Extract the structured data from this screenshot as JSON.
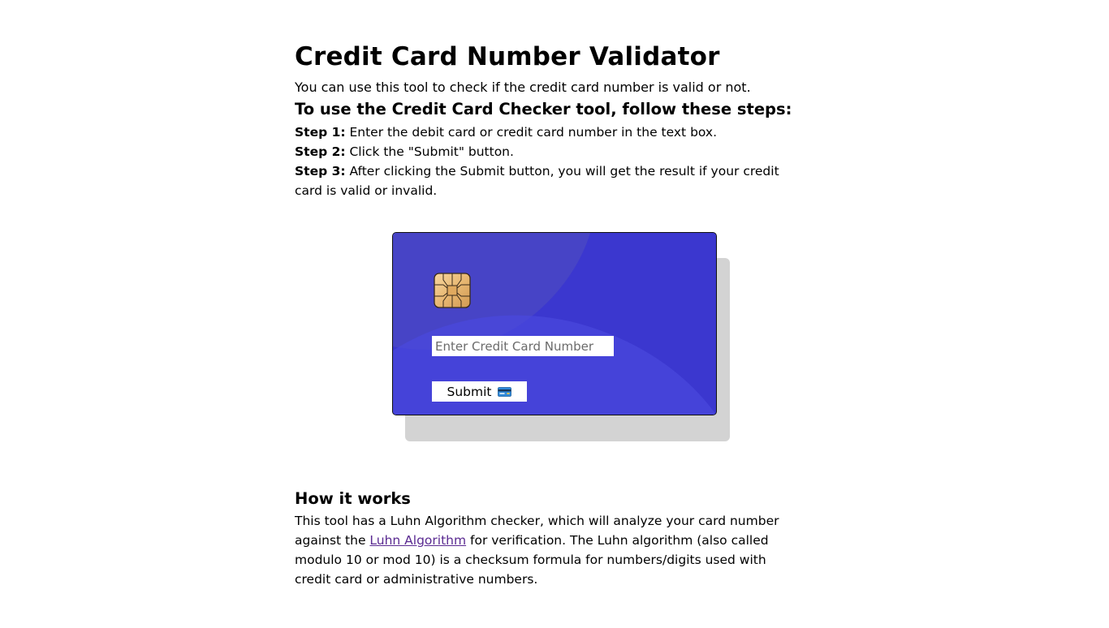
{
  "title": "Credit Card Number Validator",
  "intro": "You can use this tool to check if the credit card number is valid or not.",
  "steps_heading": "To use the Credit Card Checker tool, follow these steps:",
  "steps": [
    {
      "label": "Step 1:",
      "text": " Enter the debit card or credit card number in the text box."
    },
    {
      "label": "Step 2:",
      "text": " Click the \"Submit\" button."
    },
    {
      "label": "Step 3:",
      "text": " After clicking the Submit button, you will get the result if your credit card is valid or invalid."
    }
  ],
  "card": {
    "input_placeholder": "Enter Credit Card Number",
    "input_value": "",
    "submit_label": "Submit",
    "chip_icon": "card-chip-icon",
    "submit_icon": "credit-card-icon"
  },
  "how_it_works": {
    "heading": "How it works",
    "text_before": "This tool has a Luhn Algorithm checker, which will analyze your card number against the ",
    "link_text": "Luhn Algorithm",
    "text_after": " for verification. The Luhn algorithm (also called modulo 10 or mod 10) is a checksum formula for numbers/digits used with credit card or administrative numbers."
  },
  "colors": {
    "card_background": "#3b37cf",
    "card_shadow": "#d3d3d3",
    "link": "#5a2a91"
  }
}
